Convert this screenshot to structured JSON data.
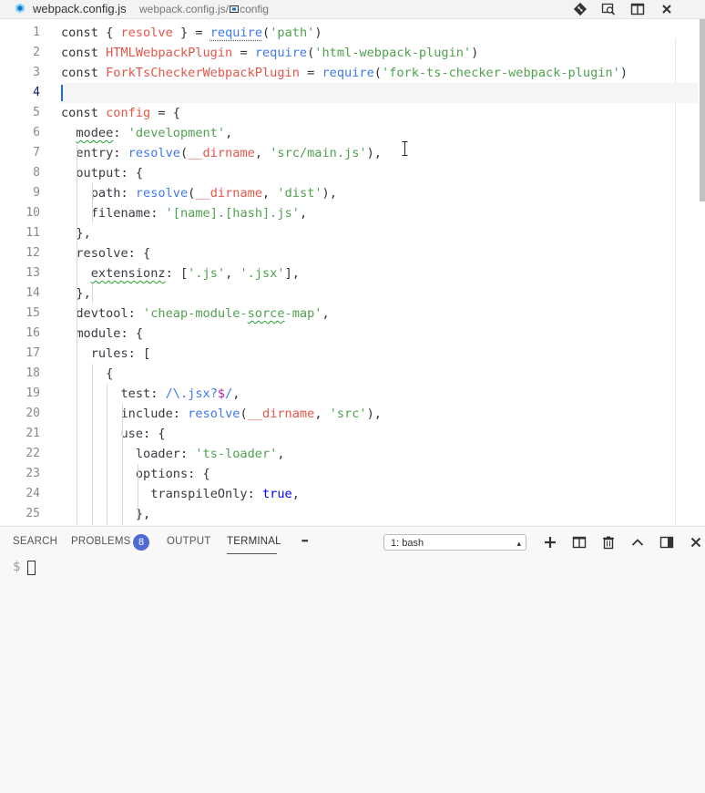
{
  "titlebar": {
    "file_name": "webpack.config.js",
    "breadcrumb_file": "webpack.config.js",
    "breadcrumb_sep": "/",
    "breadcrumb_symbol": "config",
    "icons": [
      "git-icon",
      "open-changes-icon",
      "split-editor-icon",
      "close-icon"
    ]
  },
  "editor": {
    "line_numbers": [
      "1",
      "2",
      "3",
      "4",
      "5",
      "6",
      "7",
      "8",
      "9",
      "10",
      "11",
      "12",
      "13",
      "14",
      "15",
      "16",
      "17",
      "18",
      "19",
      "20",
      "21",
      "22",
      "23",
      "24",
      "25"
    ],
    "current_line": "4",
    "lines": [
      "const { resolve } = require('path')",
      "const HTMLWebpackPlugin = require('html-webpack-plugin')",
      "const ForkTsCheckerWebpackPlugin = require('fork-ts-checker-webpack-plugin')",
      "",
      "const config = {",
      "  modee: 'development',",
      "  entry: resolve(__dirname, 'src/main.js'),",
      "  output: {",
      "    path: resolve(__dirname, 'dist'),",
      "    filename: '[name].[hash].js',",
      "  },",
      "  resolve: {",
      "    extensionz: ['.js', '.jsx'],",
      "  },",
      "  devtool: 'cheap-module-sorce-map',",
      "  module: {",
      "    rules: [",
      "      {",
      "        test: /\\.jsx?$/,",
      "        include: resolve(__dirname, 'src'),",
      "        use: {",
      "          loader: 'ts-loader',",
      "          options: {",
      "            transpileOnly: true,",
      "          },"
    ]
  },
  "panel": {
    "tabs": [
      "SEARCH",
      "PROBLEMS",
      "OUTPUT",
      "TERMINAL"
    ],
    "active_tab": "TERMINAL",
    "problems_count": "8",
    "more_label": "•••",
    "terminal_select": "1: bash",
    "prompt": "$",
    "icons": [
      "add-terminal-icon",
      "split-terminal-icon",
      "trash-icon",
      "maximize-panel-icon",
      "toggle-panel-position-icon",
      "close-panel-icon"
    ]
  },
  "colors": {
    "keyword": "#0000ff",
    "variable": "#e45649",
    "string": "#50a14f",
    "function": "#4078f2",
    "badge": "#4f6bd3"
  }
}
